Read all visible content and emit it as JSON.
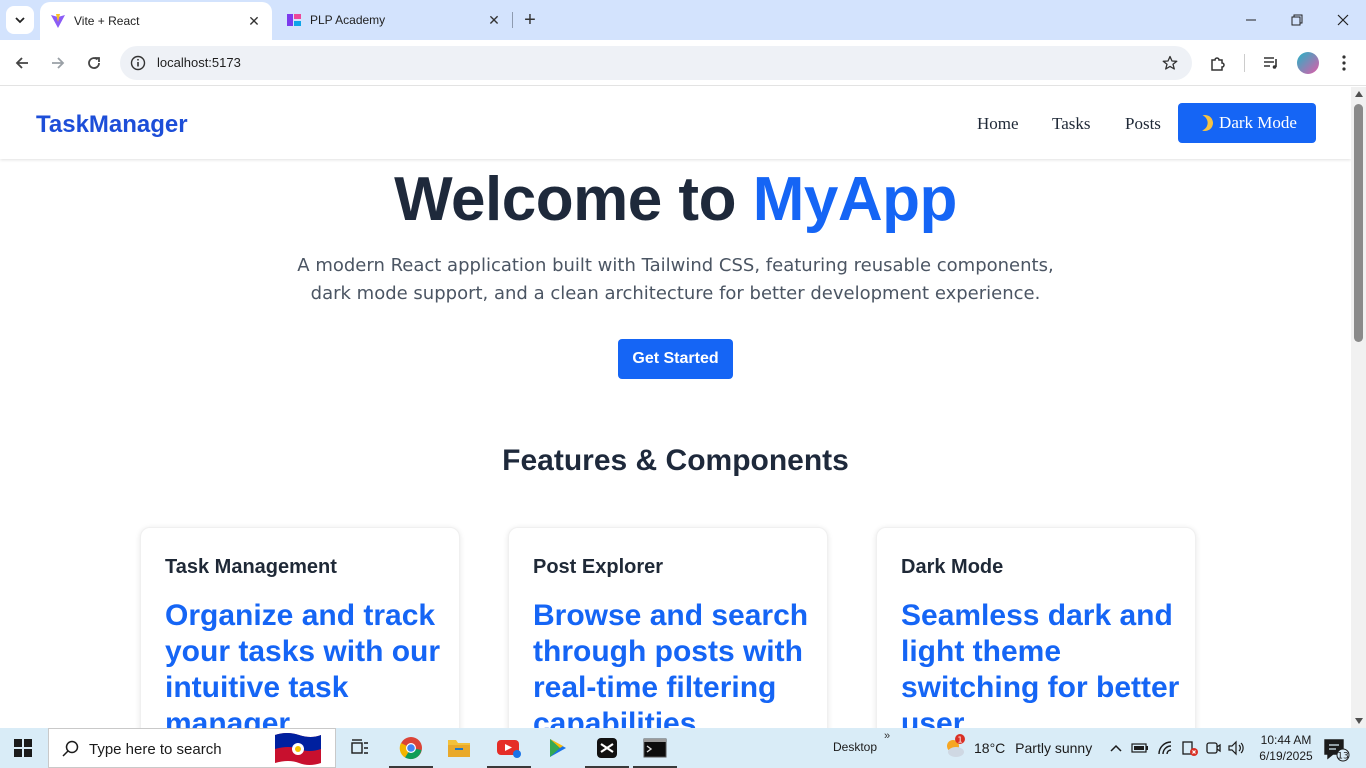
{
  "browser": {
    "tabs": [
      {
        "title": "Vite + React",
        "active": true,
        "icon": "vite-icon"
      },
      {
        "title": "PLP Academy",
        "active": false,
        "icon": "plp-icon"
      }
    ],
    "url": "localhost:5173"
  },
  "site": {
    "brand": "TaskManager",
    "nav": [
      "Home",
      "Tasks",
      "Posts"
    ],
    "dark_mode_label": "Dark Mode",
    "hero": {
      "title_prefix": "Welcome to ",
      "title_accent": "MyApp",
      "subtitle": "A modern React application built with Tailwind CSS, featuring reusable components, dark mode support, and a clean architecture for better development experience.",
      "cta": "Get Started"
    },
    "section_title": "Features & Components",
    "cards": [
      {
        "title": "Task Management",
        "body": "Organize and track your tasks with our intuitive task manager"
      },
      {
        "title": "Post Explorer",
        "body": "Browse and search through posts with real-time filtering capabilities"
      },
      {
        "title": "Dark Mode",
        "body": "Seamless dark and light theme switching for better user"
      }
    ]
  },
  "taskbar": {
    "search_placeholder": "Type here to search",
    "desktop_label": "Desktop",
    "weather": {
      "temp": "18°C",
      "condition": "Partly sunny",
      "badge": "1"
    },
    "time": "10:44 AM",
    "date": "6/19/2025",
    "notification_count": "13"
  },
  "colors": {
    "accent": "#1565f5",
    "brand": "#1d4ed8",
    "heading": "#1e293b",
    "tabstrip": "#d3e3fd",
    "taskbar": "#d9ecf7"
  }
}
